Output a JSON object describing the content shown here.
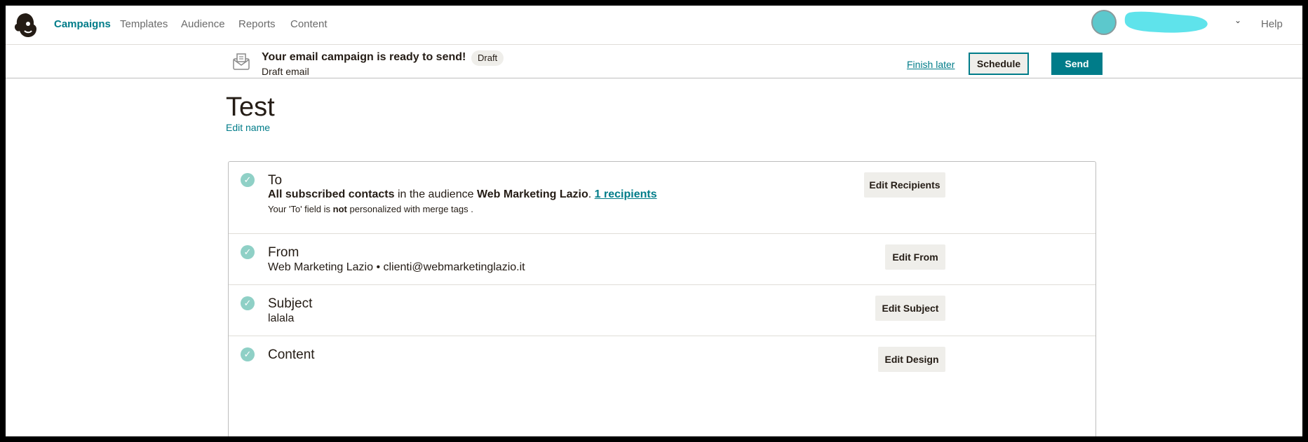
{
  "nav": {
    "items": [
      "Campaigns",
      "Templates",
      "Audience",
      "Reports",
      "Content"
    ],
    "help": "Help"
  },
  "campaign_bar": {
    "title": "Your email campaign is ready to send!",
    "badge": "Draft",
    "subtitle": "Draft email",
    "finish_later": "Finish later",
    "schedule": "Schedule",
    "send": "Send"
  },
  "campaign": {
    "name": "Test",
    "edit_name": "Edit name"
  },
  "checklist": {
    "to": {
      "title": "To",
      "audience_prefix": "All subscribed contacts",
      "audience_middle": "in the audience",
      "audience_name": "Web Marketing Lazio",
      "recipients_link": "1 recipients",
      "note_prefix": "Your 'To' field is",
      "note_bold": "not",
      "note_suffix": "personalized with merge tags .",
      "button": "Edit Recipients"
    },
    "from": {
      "title": "From",
      "value": "Web Marketing Lazio • clienti@webmarketinglazio.it",
      "button": "Edit From"
    },
    "subject": {
      "title": "Subject",
      "value": "lalala",
      "button": "Edit Subject"
    },
    "content": {
      "title": "Content",
      "button": "Edit Design"
    }
  },
  "colors": {
    "accent": "#007c89",
    "check": "#8fd0c6",
    "button_bg": "#efeeea"
  }
}
